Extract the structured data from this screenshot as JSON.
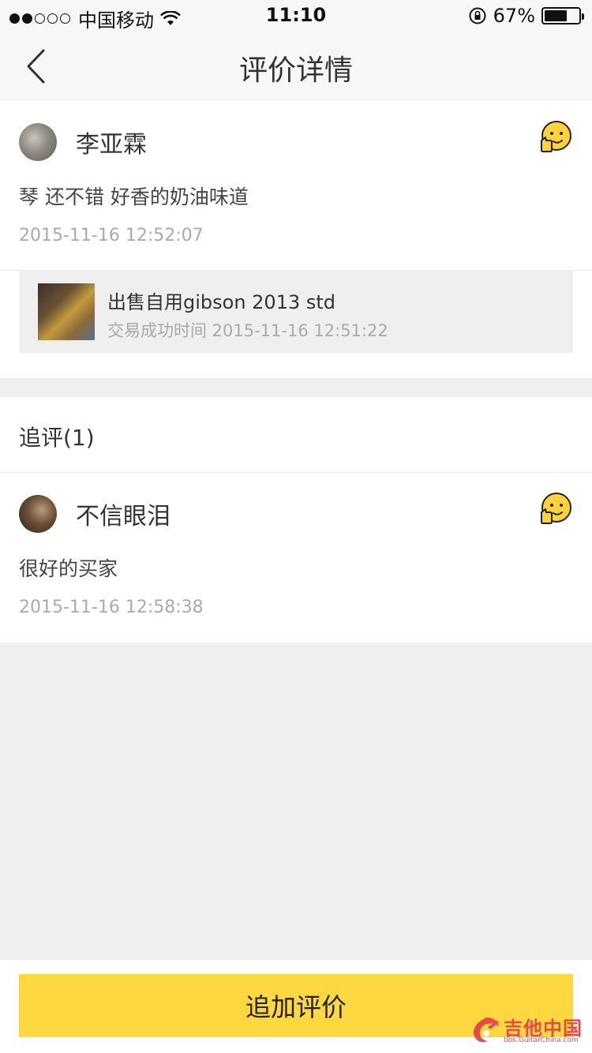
{
  "status_bar": {
    "carrier": "中国移动",
    "time": "11:10",
    "battery_percent": "67%",
    "battery_level": 0.67,
    "signal_dots_filled": 2,
    "signal_dots_total": 5,
    "icons": [
      "wifi-icon",
      "rotation-lock-icon",
      "battery-icon"
    ]
  },
  "nav": {
    "title": "评价详情",
    "back_icon": "chevron-left-icon"
  },
  "review": {
    "username": "李亚霖",
    "text": "琴 还不错 好香的奶油味道",
    "time": "2015-11-16 12:52:07",
    "rating_icon": "thumbs-up-emoji-icon",
    "product": {
      "title": "出售自用gibson 2013 std",
      "trade_time": "交易成功时间 2015-11-16 12:51:22"
    }
  },
  "followups": {
    "header": "追评(1)",
    "items": [
      {
        "username": "不信眼泪",
        "text": "很好的买家",
        "time": "2015-11-16 12:58:38",
        "rating_icon": "thumbs-up-emoji-icon"
      }
    ]
  },
  "bottom": {
    "add_review_label": "追加评价"
  },
  "watermark": {
    "text": "吉他中国",
    "subtext": "bbs.GuitarChina.com"
  },
  "colors": {
    "accent": "#fdd840",
    "background": "#efefef",
    "secondary_text": "#aaaaaa",
    "watermark": "#e84a4a"
  }
}
